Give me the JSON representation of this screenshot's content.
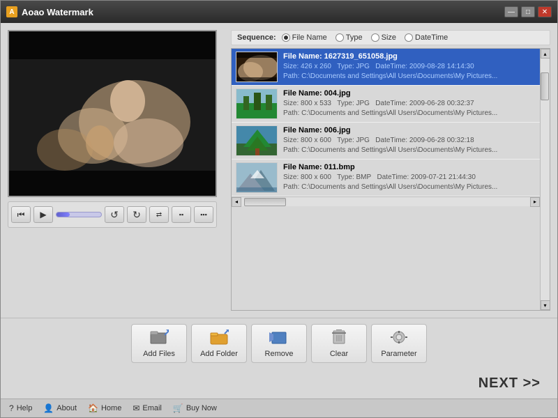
{
  "window": {
    "title": "Aoao Watermark",
    "title_icon": "A",
    "minimize_label": "—",
    "maximize_label": "□",
    "close_label": "✕"
  },
  "sequence": {
    "label": "Sequence:",
    "options": [
      {
        "label": "File Name",
        "checked": true
      },
      {
        "label": "Type",
        "checked": false
      },
      {
        "label": "Size",
        "checked": false
      },
      {
        "label": "DateTime",
        "checked": false
      }
    ]
  },
  "files": [
    {
      "name": "File Name: 1627319_651058.jpg",
      "size": "Size: 426 x 260",
      "type": "Type: JPG",
      "datetime": "DateTime: 2009-08-28 14:14:30",
      "path": "Path: C:\\Documents and Settings\\All Users\\Documents\\My Pictures...",
      "selected": true,
      "thumb_type": "scene"
    },
    {
      "name": "File Name: 004.jpg",
      "size": "Size: 800 x 533",
      "type": "Type: JPG",
      "datetime": "DateTime: 2009-06-28 00:32:37",
      "path": "Path: C:\\Documents and Settings\\All Users\\Documents\\My Pictures...",
      "selected": false,
      "thumb_type": "forest"
    },
    {
      "name": "File Name: 006.jpg",
      "size": "Size: 800 x 600",
      "type": "Type: JPG",
      "datetime": "DateTime: 2009-06-28 00:32:18",
      "path": "Path: C:\\Documents and Settings\\All Users\\Documents\\My Pictures...",
      "selected": false,
      "thumb_type": "tree"
    },
    {
      "name": "File Name: 011.bmp",
      "size": "Size: 800 x 600",
      "type": "Type: BMP",
      "datetime": "DateTime: 2009-07-21 21:44:30",
      "path": "Path: C:\\Documents and Settings\\All Users\\Documents\\My Pictures...",
      "selected": false,
      "thumb_type": "mountain"
    }
  ],
  "toolbar": {
    "add_files_label": "Add Files",
    "add_folder_label": "Add Folder",
    "remove_label": "Remove",
    "clear_label": "Clear",
    "parameter_label": "Parameter"
  },
  "next_button_label": "NEXT >>",
  "footer": {
    "help_label": "Help",
    "about_label": "About",
    "home_label": "Home",
    "email_label": "Email",
    "buy_label": "Buy Now"
  },
  "controls": {
    "prev_icon": "⏮",
    "play_icon": "▶",
    "icons": [
      "↺",
      "↻",
      "⇄",
      "◼◼",
      "◼◼◼"
    ]
  }
}
